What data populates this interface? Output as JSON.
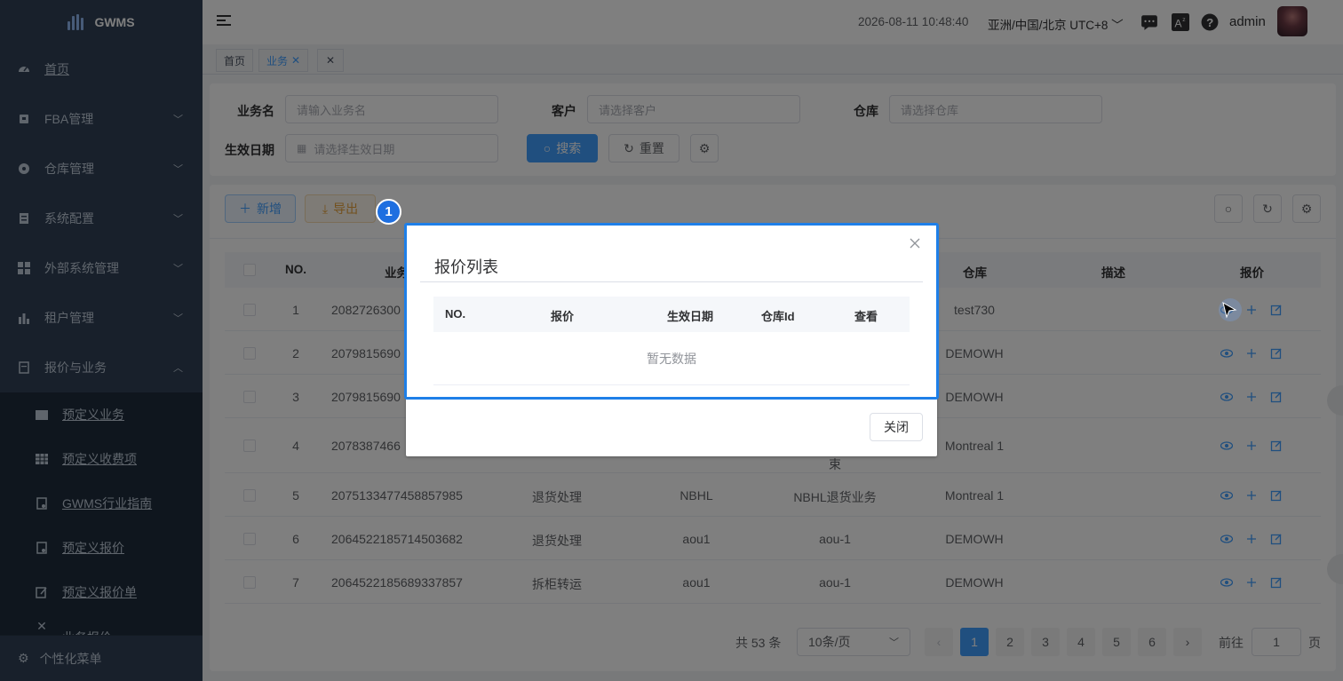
{
  "app": {
    "name": "GWMS"
  },
  "sidebar": {
    "items": [
      {
        "label": "首页",
        "icon": "dashboard-icon"
      },
      {
        "label": "FBA管理",
        "icon": "box-icon"
      },
      {
        "label": "仓库管理",
        "icon": "warehouse-icon"
      },
      {
        "label": "系统配置",
        "icon": "config-icon"
      },
      {
        "label": "外部系统管理",
        "icon": "grid-icon"
      },
      {
        "label": "租户管理",
        "icon": "chart-icon"
      },
      {
        "label": "报价与业务",
        "icon": "quote-icon"
      }
    ],
    "subitems": [
      {
        "label": "预定义业务",
        "icon": "folder-icon"
      },
      {
        "label": "预定义收费项",
        "icon": "table-icon"
      },
      {
        "label": "GWMS行业指南",
        "icon": "doc-icon"
      },
      {
        "label": "预定义报价",
        "icon": "doc-icon"
      },
      {
        "label": "预定义报价单",
        "icon": "edit-icon"
      },
      {
        "label": "业务报价",
        "icon": "x-icon"
      }
    ],
    "bottom": "个性化菜单"
  },
  "header": {
    "datetime": "2026-08-11 10:48:40",
    "timezone": "亚洲/中国/北京 UTC+8",
    "user": "admin"
  },
  "tags": [
    {
      "label": "首页"
    },
    {
      "label": "业务"
    },
    {
      "label": ""
    }
  ],
  "search": {
    "name_label": "业务名",
    "name_placeholder": "请输入业务名",
    "customer_label": "客户",
    "customer_placeholder": "请选择客户",
    "warehouse_label": "仓库",
    "warehouse_placeholder": "请选择仓库",
    "date_label": "生效日期",
    "date_placeholder": "请选择生效日期",
    "search_btn": "搜索",
    "reset_btn": "重置"
  },
  "toolbar": {
    "add_btn": "新增",
    "export_btn": "导出"
  },
  "table": {
    "headers": {
      "no": "NO.",
      "name": "业务",
      "warehouse": "仓库",
      "desc": "描述",
      "quote": "报价"
    },
    "rows": [
      {
        "no": "1",
        "id": "2082726300",
        "type": "",
        "customer": "",
        "biz": "",
        "warehouse": "test730"
      },
      {
        "no": "2",
        "id": "2079815690",
        "type": "",
        "customer": "",
        "biz": "",
        "warehouse": "DEMOWH"
      },
      {
        "no": "3",
        "id": "2079815690",
        "type": "",
        "customer": "",
        "biz": "",
        "warehouse": "DEMOWH"
      },
      {
        "no": "4",
        "id": "2078387466",
        "type": "",
        "customer": "",
        "biz": "束",
        "warehouse": "Montreal 1"
      },
      {
        "no": "5",
        "id": "2075133477458857985",
        "type": "退货处理",
        "customer": "NBHL",
        "biz": "NBHL退货业务",
        "warehouse": "Montreal 1"
      },
      {
        "no": "6",
        "id": "2064522185714503682",
        "type": "退货处理",
        "customer": "aou1",
        "biz": "aou-1",
        "warehouse": "DEMOWH"
      },
      {
        "no": "7",
        "id": "2064522185689337857",
        "type": "拆柜转运",
        "customer": "aou1",
        "biz": "aou-1",
        "warehouse": "DEMOWH"
      }
    ]
  },
  "pagination": {
    "total": "共 53 条",
    "page_size": "10条/页",
    "pages": [
      "1",
      "2",
      "3",
      "4",
      "5",
      "6"
    ],
    "goto_label": "前往",
    "goto_value": "1",
    "page_suffix": "页"
  },
  "dialog": {
    "title": "报价列表",
    "headers": {
      "no": "NO.",
      "quote": "报价",
      "date": "生效日期",
      "warehouse_id": "仓库Id",
      "view": "查看"
    },
    "empty": "暂无数据",
    "close_btn": "关闭"
  },
  "step_badge": "1"
}
